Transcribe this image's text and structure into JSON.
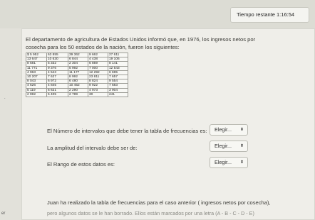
{
  "timer": {
    "label": "Tiempo restante",
    "value": "1:16:54"
  },
  "sidebar": {
    "letter": "er",
    "bullet": "."
  },
  "intro": {
    "line1": "El departamento de agricultura de Estados Unidos informó que, en 1976, los ingresos netos por",
    "line2": "cosecha para los 50 estados de la nación, fueron los siguientes:"
  },
  "table": {
    "rows": [
      [
        "$ 5 952",
        "63 855",
        "39 362",
        "9 662",
        "27 611"
      ],
      [
        "13 647",
        "10 630",
        "6 844",
        "4 438",
        "19 106"
      ],
      [
        "8 681",
        "5 332",
        "2 304",
        "6 859",
        "8 141"
      ],
      [
        "11 771",
        "9 376",
        "5 992",
        "7 000",
        "12 543"
      ],
      [
        "4 963",
        "4 543",
        "11 177",
        "12 292",
        "6 695"
      ],
      [
        "10 207",
        "7 627",
        "8 992",
        "23 811",
        "7 657"
      ],
      [
        "8 043",
        "6 972",
        "6 480",
        "8 824",
        "9 554"
      ],
      [
        "4 626",
        "4 845",
        "10 452",
        "9 922",
        "7 683"
      ],
      [
        "5 119",
        "6 621",
        "2 290",
        "4 973",
        "3 904"
      ],
      [
        "2 992",
        "5 405",
        "2 789",
        "30",
        "241"
      ]
    ]
  },
  "questions": [
    {
      "text": "El Número de intervalos que debe tener la tabla de frecuencias es:",
      "select": "Elegir..."
    },
    {
      "text": "La amplitud del intervalo debe  ser de:",
      "select": "Elegir..."
    },
    {
      "text": "El Rango de estos datos es:",
      "select": "Elegir..."
    }
  ],
  "select_arrow": "⬍",
  "bottom": {
    "line1": "Juan ha realizado la tabla de frecuencias para el caso anterior ( ingresos netos por cosecha),",
    "line2": "pero algunos datos se le han borrado. Ellos están marcados por una letra (A - B - C - D - E)"
  }
}
